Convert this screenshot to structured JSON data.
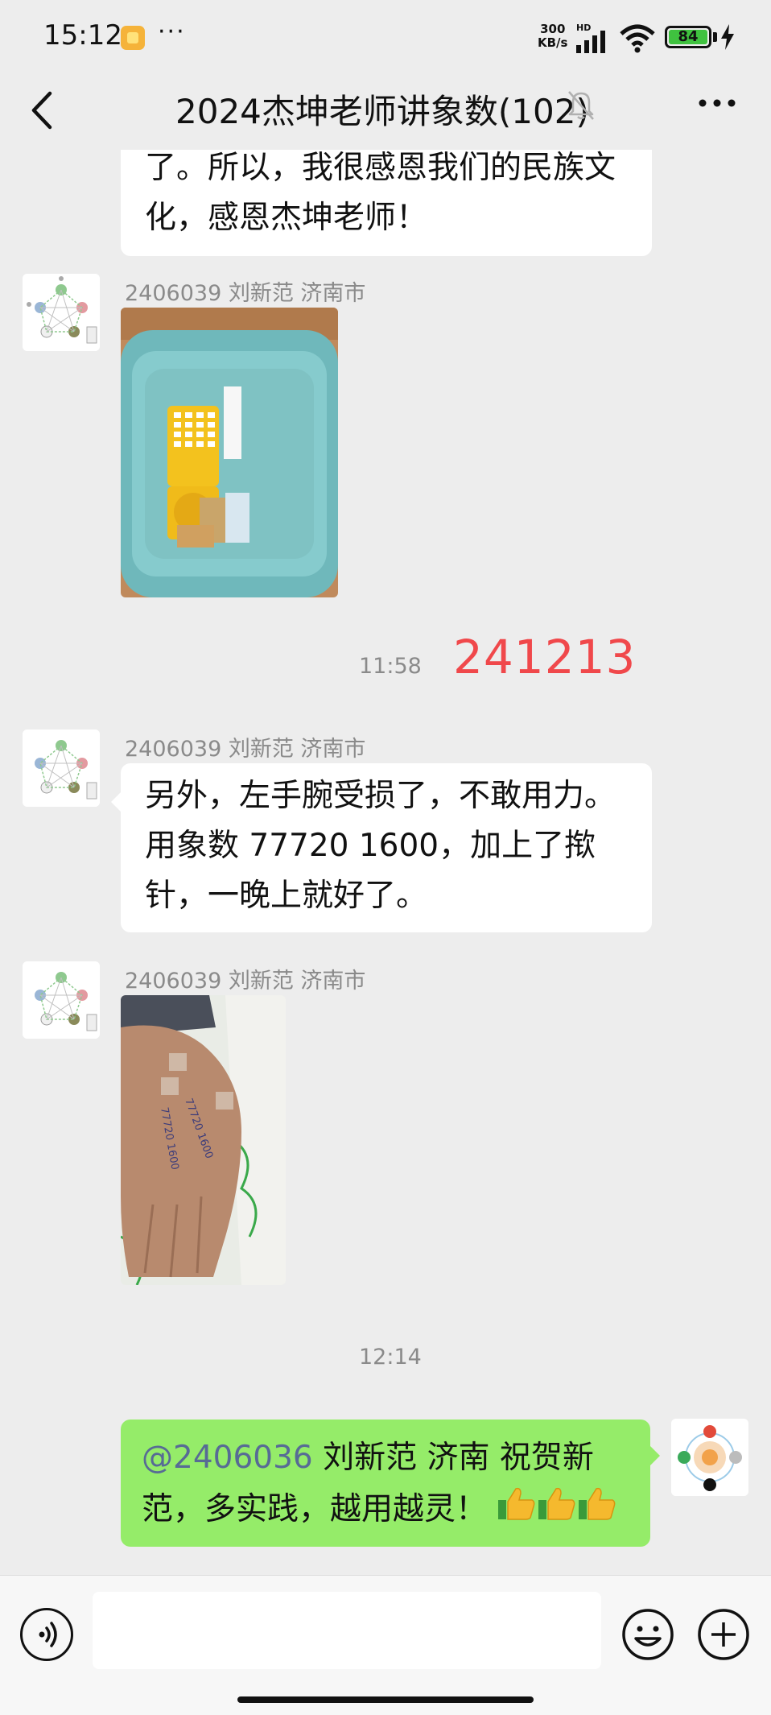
{
  "status_bar": {
    "time": "15:12",
    "more": "···",
    "net_speed_value": "300",
    "net_speed_unit": "KB/s",
    "hd": "HD",
    "battery": "84"
  },
  "header": {
    "title": "2024杰坤老师讲象数(102)"
  },
  "messages": [
    {
      "type": "text",
      "from": "other",
      "text": "了。所以，我很感恩我们的民族文化，感恩杰坤老师！"
    },
    {
      "type": "image",
      "from": "other",
      "sender": "2406039 刘新范 济南市"
    },
    {
      "type": "time",
      "time": "11:58"
    },
    {
      "type": "annotation",
      "text": "241213",
      "color": "#f0484b"
    },
    {
      "type": "text",
      "from": "other",
      "sender": "2406039 刘新范 济南市",
      "text": "另外，左手腕受损了，不敢用力。用象数 77720  1600，加上了揿针，一晚上就好了。"
    },
    {
      "type": "image",
      "from": "other",
      "sender": "2406039 刘新范 济南市"
    },
    {
      "type": "time",
      "time": "12:14"
    },
    {
      "type": "text",
      "from": "self",
      "mention": "@2406036",
      "text": " 刘新范 济南  祝贺新范，多实践，越用越灵！"
    }
  ],
  "hand_photo_writing": "77720 1600",
  "colors": {
    "background": "#ededed",
    "bubble_self": "#95ec69",
    "bubble_other": "#ffffff",
    "mention": "#576b95",
    "annotation": "#f0484b"
  },
  "icons": {
    "back": "chevron-left-icon",
    "mute": "bell-off-icon",
    "more": "more-dots-icon",
    "voice": "voice-icon",
    "emoji": "emoji-icon",
    "plus": "plus-icon"
  }
}
